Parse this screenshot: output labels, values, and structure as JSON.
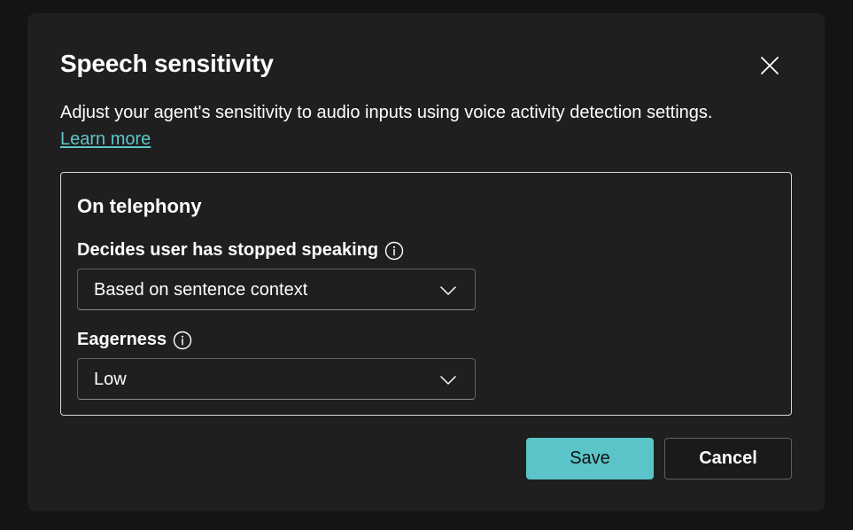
{
  "dialog": {
    "title": "Speech sensitivity",
    "description": "Adjust your agent's sensitivity to audio inputs using voice activity detection settings.",
    "learn_more": "Learn more",
    "close_icon": "close-icon"
  },
  "panel": {
    "title": "On telephony",
    "fields": [
      {
        "label": "Decides user has stopped speaking",
        "info_icon": "info-icon",
        "value": "Based on sentence context",
        "dropdown_icon": "chevron-down-icon"
      },
      {
        "label": "Eagerness",
        "info_icon": "info-icon",
        "value": "Low",
        "dropdown_icon": "chevron-down-icon"
      }
    ]
  },
  "footer": {
    "save_label": "Save",
    "cancel_label": "Cancel"
  },
  "colors": {
    "background": "#141414",
    "dialog": "#1f1f1f",
    "accent": "#5bc4c8",
    "link": "#5ec6c9"
  }
}
